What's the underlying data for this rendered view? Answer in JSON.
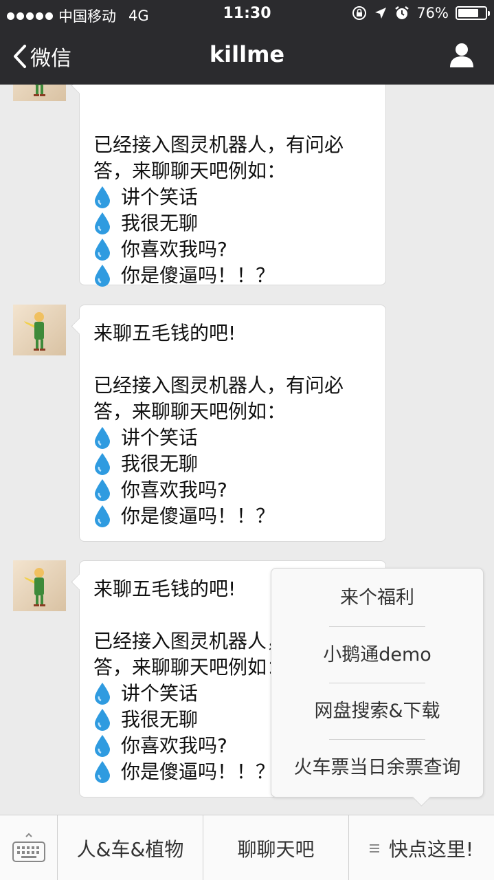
{
  "status_bar": {
    "carrier": "中国移动",
    "network": "4G",
    "time": "11:30",
    "battery": "76%",
    "battery_level": 0.76
  },
  "nav": {
    "back_label": "微信",
    "title": "killme"
  },
  "messages": [
    {
      "greeting": "",
      "body_lines": [
        "已经接入图灵机器人，有问必",
        "答，来聊聊天吧例如："
      ],
      "items": [
        "讲个笑话",
        "我很无聊",
        "你喜欢我吗?",
        "你是傻逼吗！！？"
      ]
    },
    {
      "greeting": "来聊五毛钱的吧!",
      "body_lines": [
        "已经接入图灵机器人，有问必",
        "答，来聊聊天吧例如："
      ],
      "items": [
        "讲个笑话",
        "我很无聊",
        "你喜欢我吗?",
        "你是傻逼吗！！？"
      ]
    },
    {
      "greeting": "来聊五毛钱的吧!",
      "body_lines": [
        "已经接入图灵机器人，有问必",
        "答，来聊聊天吧例如："
      ],
      "items": [
        "讲个笑话",
        "我很无聊",
        "你喜欢我吗?",
        "你是傻逼吗！！？"
      ]
    }
  ],
  "popup_menu": {
    "items": [
      "来个福利",
      "小鹅通demo",
      "网盘搜索&下载",
      "火车票当日余票查询"
    ]
  },
  "bottom_menu": {
    "items": [
      "人&车&植物",
      "聊聊天吧",
      "快点这里!"
    ]
  },
  "colors": {
    "bar_dark": "#2b2b2e",
    "chat_bg": "#ebebeb",
    "drop_blue": "#2f9be0"
  }
}
